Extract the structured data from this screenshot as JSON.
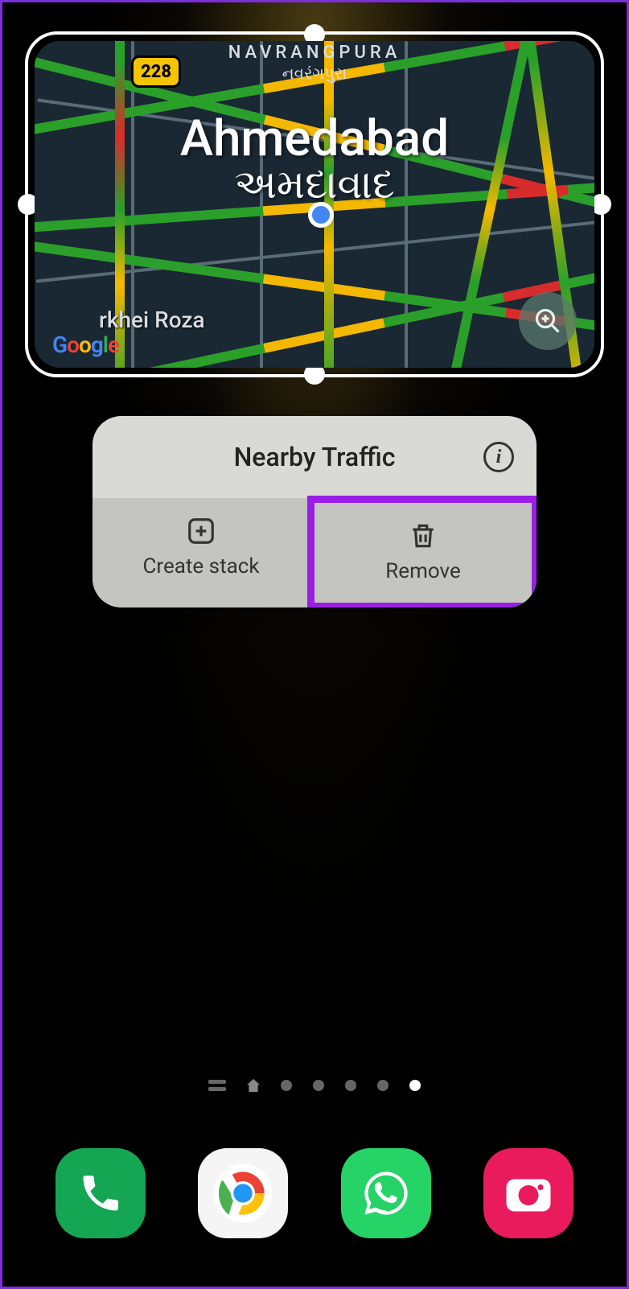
{
  "widget": {
    "area_label": "NAVRANGPURA",
    "area_label_local": "નવરંગપુરા",
    "city": "Ahmedabad",
    "city_local": "અમદાવાદ",
    "road_shield": "228",
    "poi": "rkhei Roza",
    "logo": "Google"
  },
  "popup": {
    "title": "Nearby Traffic",
    "actions": {
      "create_stack": "Create stack",
      "remove": "Remove"
    }
  },
  "pages": {
    "total": 7,
    "current": 7
  },
  "dock": {
    "apps": [
      "Phone",
      "Chrome",
      "WhatsApp",
      "Camera"
    ]
  }
}
